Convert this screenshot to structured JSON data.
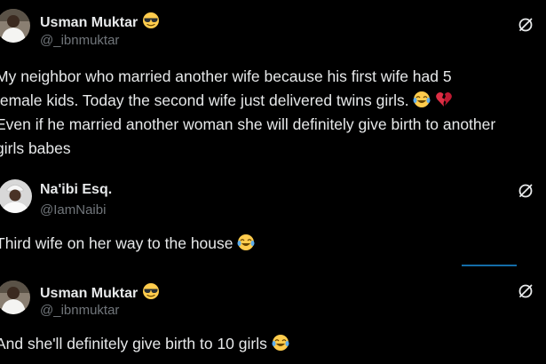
{
  "posts": [
    {
      "display_name": "Usman Muktar",
      "handle": "@_ibnmuktar",
      "lines": [
        "My neighbor who married another wife because his first wife had 5",
        "female kids. Today the second wife just delivered twins girls.",
        "Even if he married another woman she will definitely give birth to another",
        "girls babes"
      ],
      "avatar_icon": "user-avatar-white-robe",
      "name_emoji_icon": "smiling-face-with-sunglasses-icon",
      "line2_emoji_icons": [
        "face-with-tears-of-joy-icon",
        "broken-heart-icon"
      ]
    },
    {
      "display_name": "Na'ibi Esq.",
      "handle": "@IamNaibi",
      "lines": [
        "Third wife on her way to the house"
      ],
      "avatar_icon": "user-avatar-white-cap",
      "line1_emoji_icon": "face-with-tears-of-joy-icon"
    },
    {
      "display_name": "Usman Muktar",
      "handle": "@_ibnmuktar",
      "lines": [
        "And she'll definitely give birth to 10 girls"
      ],
      "avatar_icon": "user-avatar-white-robe",
      "name_emoji_icon": "smiling-face-with-sunglasses-icon",
      "line1_emoji_icon": "face-with-tears-of-joy-icon"
    }
  ],
  "colors": {
    "background": "#000000",
    "text": "#e7e9ea",
    "secondary": "#71767b",
    "accent": "#1d9bf0"
  },
  "grok_icon": "grok-slash-circle-icon"
}
